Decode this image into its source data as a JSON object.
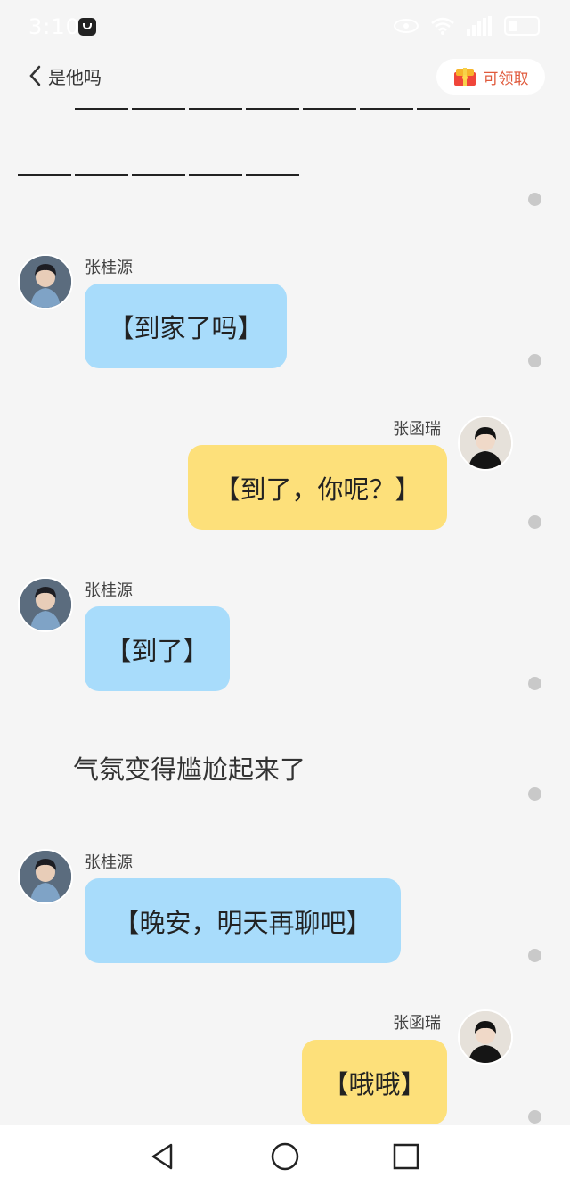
{
  "status_bar": {
    "time": "3:10",
    "icons": [
      "app-notification-icon",
      "eye-icon",
      "wifi-icon",
      "signal-icon",
      "battery-icon"
    ]
  },
  "header": {
    "title": "是他吗",
    "back_icon": "chevron-left-icon",
    "redpack_label": "可领取",
    "redpack_icon": "red-packet-icon"
  },
  "messages": [
    {
      "side": "left",
      "sender": "张桂源",
      "text": "【到家了吗】",
      "color": "#a8dcfb"
    },
    {
      "side": "right",
      "sender": "张函瑞",
      "text": "【到了，你呢？】",
      "color": "#fde07a"
    },
    {
      "side": "left",
      "sender": "张桂源",
      "text": "【到了】",
      "color": "#a8dcfb"
    },
    {
      "side": "narration",
      "text": "气氛变得尴尬起来了"
    },
    {
      "side": "left",
      "sender": "张桂源",
      "text": "【晚安，明天再聊吧】",
      "color": "#a8dcfb"
    },
    {
      "side": "right",
      "sender": "张函瑞",
      "text": "【哦哦】",
      "color": "#fde07a"
    }
  ],
  "nav": {
    "icons": [
      "back-triangle-icon",
      "home-circle-icon",
      "recents-square-icon"
    ]
  }
}
